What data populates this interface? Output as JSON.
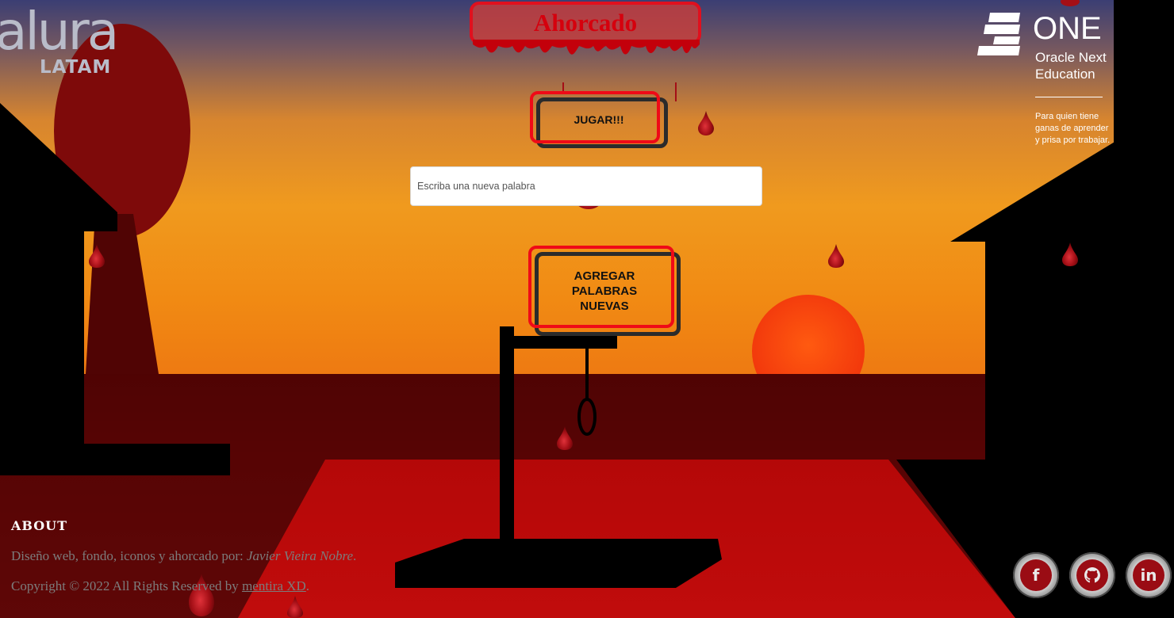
{
  "header": {
    "title": "Ahorcado"
  },
  "logos": {
    "alura": {
      "name": "alura",
      "subtitle": "LATAM"
    },
    "one": {
      "name": "ONE",
      "subtitle_line1": "Oracle Next",
      "subtitle_line2": "Education",
      "tagline_line1": "Para quien tiene",
      "tagline_line2": "ganas de aprender",
      "tagline_line3": "y prisa por trabajar."
    }
  },
  "actions": {
    "play_label": "JUGAR!!!",
    "add_words_label_line1": "AGREGAR",
    "add_words_label_line2": "PALABRAS",
    "add_words_label_line3": "NUEVAS"
  },
  "word_input": {
    "value": "",
    "placeholder": "Escriba una nueva palabra"
  },
  "footer": {
    "heading": "ABOUT",
    "credits_prefix": "Diseño web, fondo, iconos y ahorcado por: ",
    "credits_author": "Javier Vieira Nobre",
    "credits_suffix": ".",
    "copyright_prefix": "Copyright © 2022 All Rights Reserved by ",
    "copyright_link": "mentira XD",
    "copyright_suffix": "."
  },
  "social": [
    {
      "icon": "facebook-icon",
      "glyph": "f"
    },
    {
      "icon": "github-icon",
      "glyph": ""
    },
    {
      "icon": "linkedin-icon",
      "glyph": "in"
    }
  ],
  "colors": {
    "accent_red": "#ef0a17",
    "title_red": "#d5000d",
    "blood": "#9a0c14",
    "silhouette": "#000000"
  }
}
